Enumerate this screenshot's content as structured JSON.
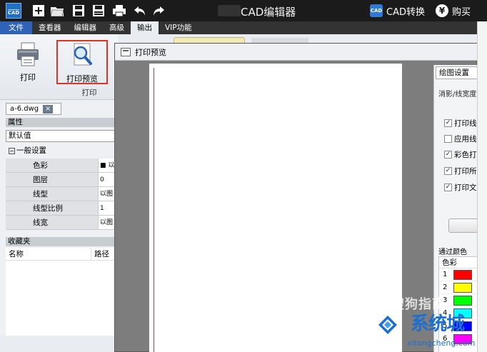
{
  "titlebar": {
    "title": "CAD编辑器",
    "logo_text": "CAD",
    "cad_convert_badge": "CAD",
    "cad_convert_label": "CAD转换",
    "buy_symbol": "¥",
    "buy_label": "购买",
    "icons": [
      "new-icon",
      "open-folder-icon",
      "save-icon",
      "save-as-icon",
      "print-icon",
      "undo-icon",
      "redo-icon"
    ]
  },
  "menubar": {
    "items": [
      "文件",
      "查看器",
      "编辑器",
      "高级",
      "输出",
      "VIP功能"
    ],
    "active_index": 4
  },
  "ribbon": {
    "print_label": "打印",
    "preview_label": "打印预览",
    "group_label": "打印",
    "highlight_color": "#d9342b"
  },
  "leftpanel": {
    "file_tab": "a-6.dwg",
    "properties_header": "属性",
    "default_value": "默认值",
    "general_group": "一般设置",
    "properties": [
      {
        "key": "色彩",
        "value": "■ 以"
      },
      {
        "key": "图层",
        "value": "0"
      },
      {
        "key": "线型",
        "value": "以图"
      },
      {
        "key": "线型比例",
        "value": "1"
      },
      {
        "key": "线宽",
        "value": "以图"
      }
    ],
    "favorites_header": "收藏夹",
    "favorites_columns": [
      "名称",
      "路径"
    ]
  },
  "preview_window": {
    "title": "打印预览",
    "settings_tab": "绘图设置",
    "settings_sub": "消影/线宽度",
    "options": [
      {
        "label": "打印线",
        "checked": true
      },
      {
        "label": "应用线",
        "checked": false
      },
      {
        "label": "彩色打",
        "checked": true
      },
      {
        "label": "打印所",
        "checked": true
      },
      {
        "label": "打印文",
        "checked": true
      }
    ],
    "color_section": "通过颜色",
    "color_column": "色彩",
    "colors": [
      {
        "index": "1",
        "color": "#ff0000"
      },
      {
        "index": "2",
        "color": "#ffff00"
      },
      {
        "index": "3",
        "color": "#00ff00"
      },
      {
        "index": "4",
        "color": "#00ffff"
      },
      {
        "index": "5",
        "color": "#0000ff"
      },
      {
        "index": "6",
        "color": "#ff00ff"
      }
    ]
  },
  "watermark": {
    "line1": "搜狗指南",
    "brand": "系统城",
    "url": "xitongcheng.com"
  }
}
